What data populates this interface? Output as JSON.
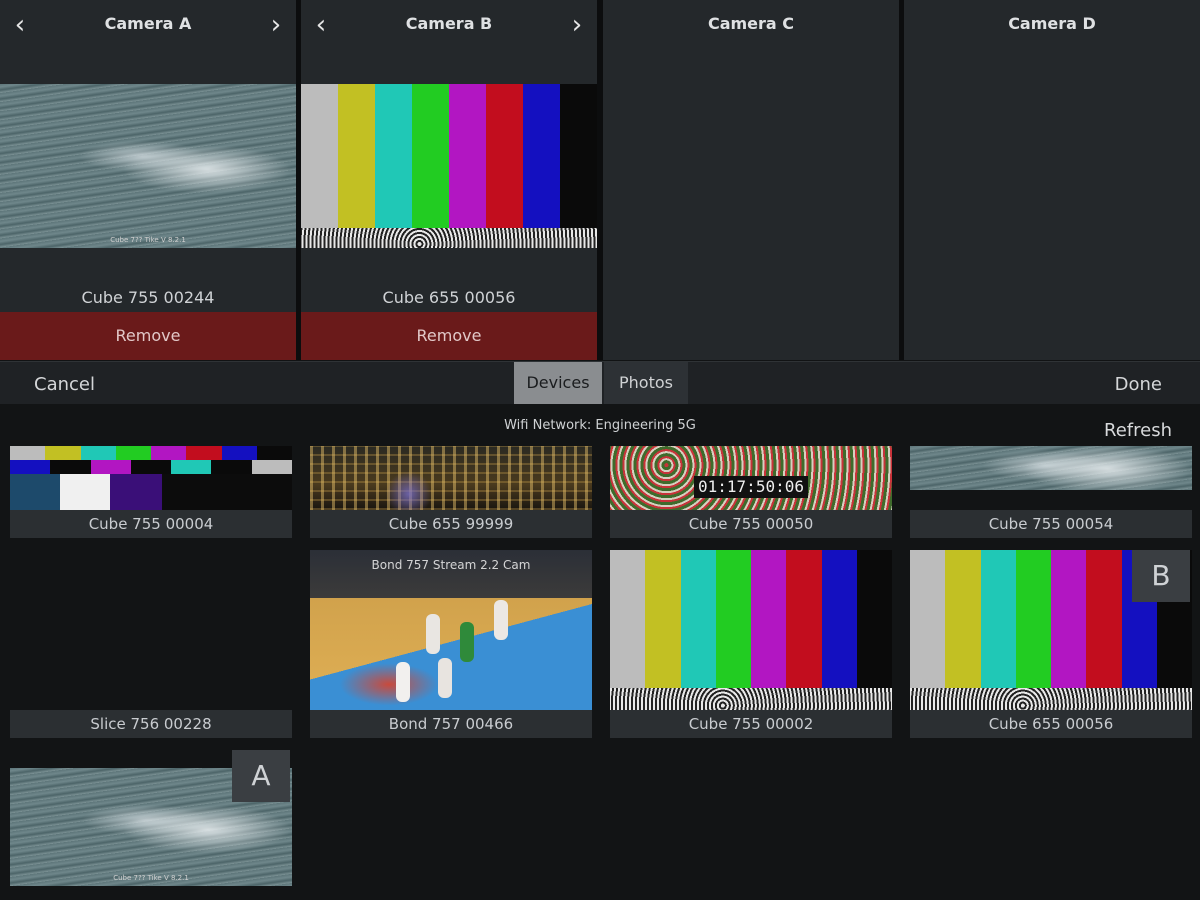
{
  "cameras": [
    {
      "title": "Camera A",
      "device": "Cube 755 00244",
      "remove_label": "Remove",
      "feed": "sea",
      "feed_caption": "Cube 7?? Tike V 8.2.1",
      "has_arrows": true
    },
    {
      "title": "Camera B",
      "device": "Cube 655 00056",
      "remove_label": "Remove",
      "feed": "bars",
      "has_arrows": true
    },
    {
      "title": "Camera C",
      "has_arrows": false
    },
    {
      "title": "Camera D",
      "has_arrows": false
    }
  ],
  "nav": {
    "prev_icon": "chevron-left-icon",
    "next_icon": "chevron-right-icon"
  },
  "picker": {
    "cancel_label": "Cancel",
    "done_label": "Done",
    "tabs": [
      {
        "label": "Devices",
        "selected": true
      },
      {
        "label": "Photos",
        "selected": false
      }
    ],
    "network": "Wifi Network: Engineering 5G",
    "refresh_label": "Refresh",
    "devices": [
      {
        "name": "Cube 755 00004",
        "preview": "smpte"
      },
      {
        "name": "Cube 655 99999",
        "preview": "city"
      },
      {
        "name": "Cube 755 00050",
        "preview": "flowers",
        "timecode": "01:17:50:06"
      },
      {
        "name": "Cube 755 00054",
        "preview": "sea"
      },
      {
        "name": "Slice 756 00228",
        "preview": "none"
      },
      {
        "name": "Bond 757 00466",
        "preview": "court",
        "overlay": "Bond 757 Stream 2.2 Cam"
      },
      {
        "name": "Cube 755 00002",
        "preview": "bars"
      },
      {
        "name": "Cube 655 00056",
        "preview": "bars",
        "slot": "B"
      },
      {
        "name": "",
        "preview": "sea",
        "slot": "A",
        "feed_caption": "Cube 7?? Tike V 8.2.1"
      }
    ]
  },
  "colors": {
    "remove_bg": "#6a1a1a",
    "bar_colors": [
      "#bcbcbc",
      "#c2c023",
      "#20c8b6",
      "#22cc22",
      "#b216c2",
      "#c20d1e",
      "#1410c0",
      "#0a0a0a"
    ]
  }
}
